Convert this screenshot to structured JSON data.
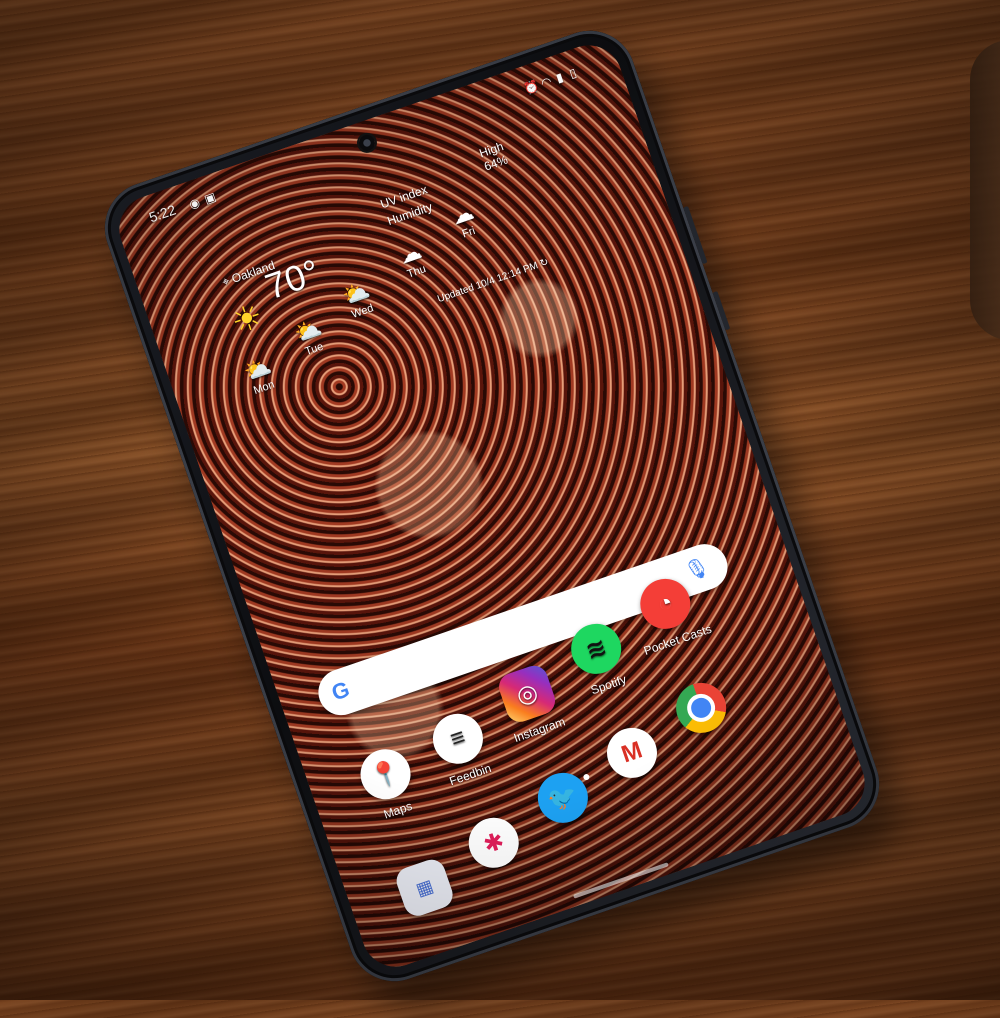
{
  "status_bar": {
    "time": "5:22"
  },
  "weather": {
    "location": "Oakland",
    "temperature": "70°",
    "high_label": "High",
    "high_value": "64%",
    "uv_label": "UV index",
    "humidity_label": "Humidity",
    "days": [
      {
        "name": "Mon",
        "icon": "partly-sunny-icon"
      },
      {
        "name": "Tue",
        "icon": "partly-sunny-icon"
      },
      {
        "name": "Wed",
        "icon": "partly-sunny-icon"
      },
      {
        "name": "Thu",
        "icon": "cloud-icon"
      },
      {
        "name": "Fri",
        "icon": "cloud-icon"
      }
    ],
    "updated": "Updated 10/4 12:14 PM"
  },
  "search": {
    "logo": "G",
    "mic_icon": "microphone-icon"
  },
  "apps_row_1": [
    {
      "label": "Maps",
      "icon": "google-maps-icon"
    },
    {
      "label": "Feedbin",
      "icon": "feedbin-icon"
    },
    {
      "label": "Instagram",
      "icon": "instagram-icon"
    },
    {
      "label": "Spotify",
      "icon": "spotify-icon"
    },
    {
      "label": "Pocket Casts",
      "icon": "pocket-casts-icon"
    }
  ],
  "dock": [
    {
      "icon": "app-folder-icon"
    },
    {
      "icon": "slack-icon"
    },
    {
      "icon": "twitter-icon"
    },
    {
      "icon": "gmail-icon"
    },
    {
      "icon": "chrome-icon"
    }
  ],
  "colors": {
    "wood": "#7a4521",
    "wallpaper_red": "#b7452a",
    "google_blue": "#4285f4",
    "spotify_green": "#1ed760",
    "pocket_casts_red": "#f43e37",
    "twitter_blue": "#1da1f2"
  }
}
